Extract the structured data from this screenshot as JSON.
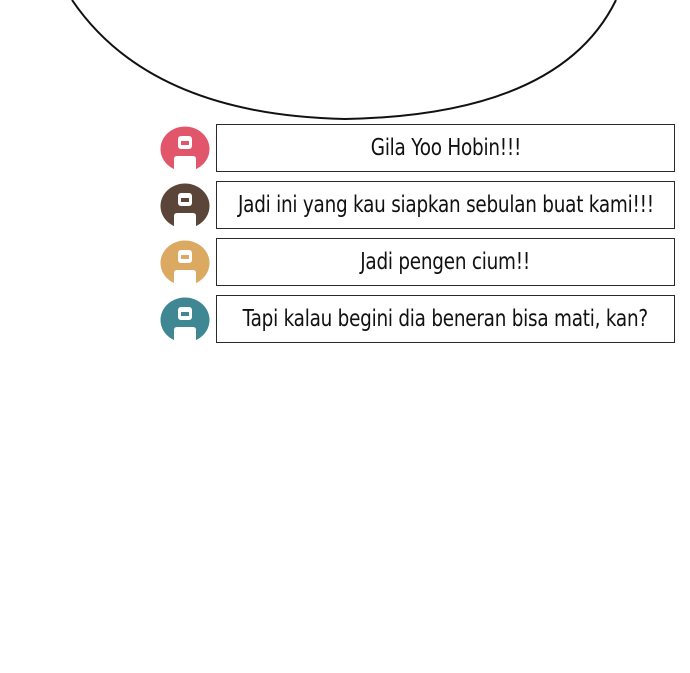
{
  "messages": [
    {
      "text": "Gila Yoo Hobin!!!",
      "avatar_color": "#e2566b"
    },
    {
      "text": "Jadi ini yang kau siapkan sebulan buat kami!!!",
      "avatar_color": "#5a4538"
    },
    {
      "text": "Jadi pengen cium!!",
      "avatar_color": "#dba962"
    },
    {
      "text": "Tapi kalau begini dia beneran bisa mati, kan?",
      "avatar_color": "#3f8792"
    }
  ],
  "icons": {
    "avatar": "person-avatar-icon"
  }
}
